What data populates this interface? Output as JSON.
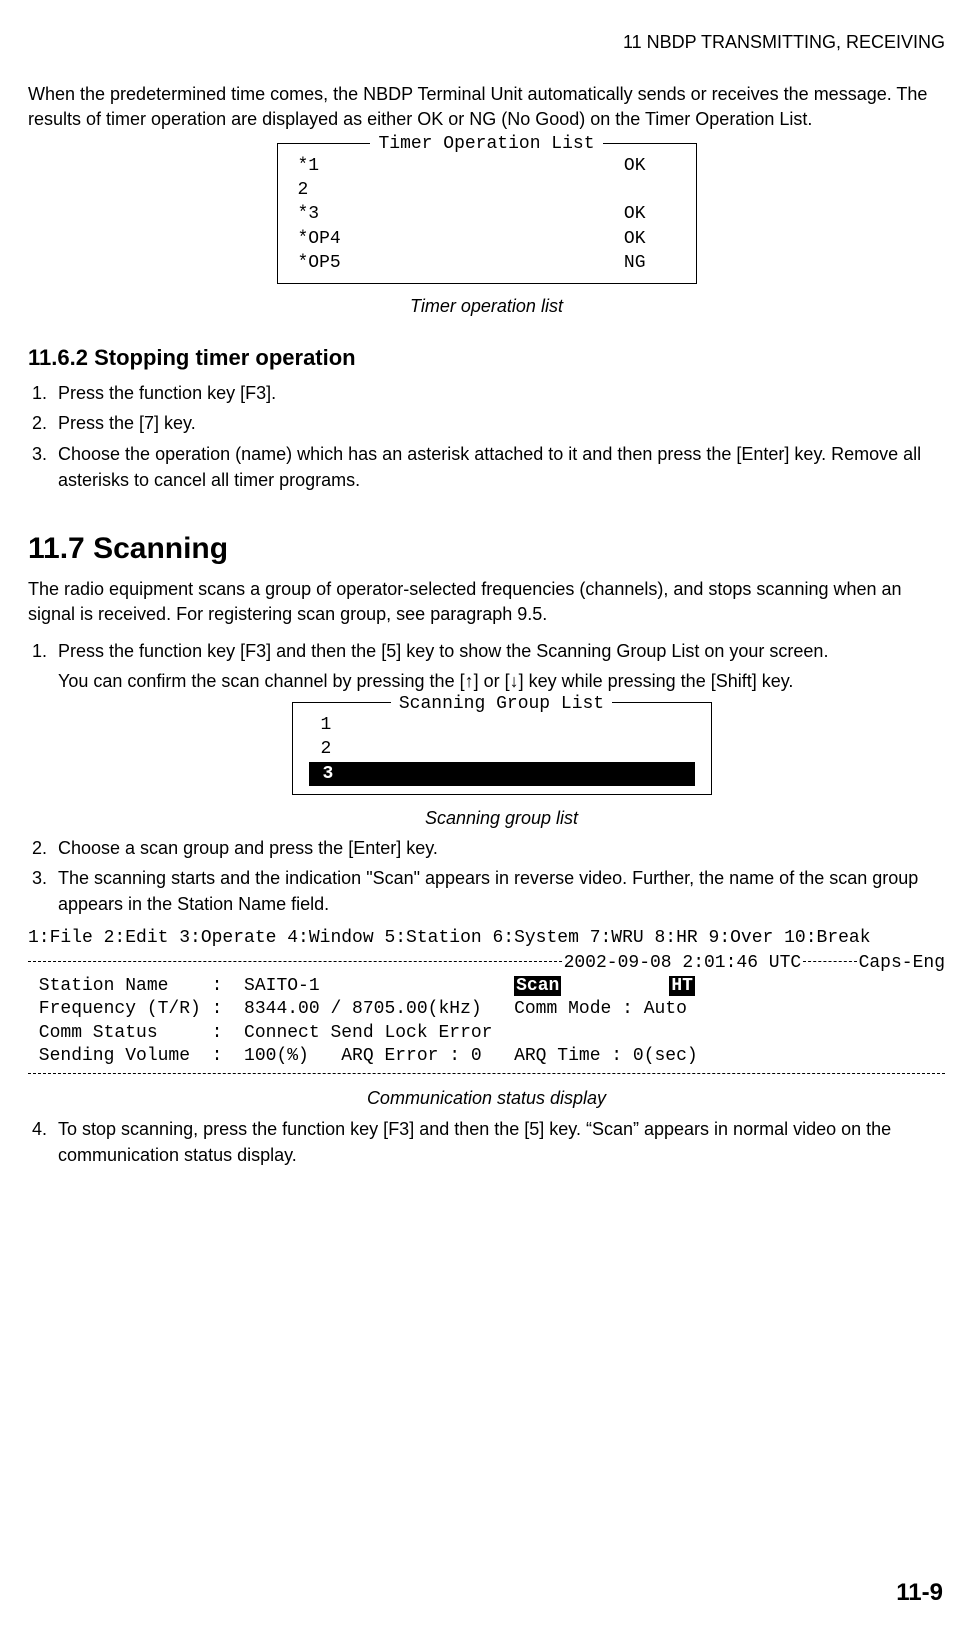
{
  "header": "11  NBDP TRANSMITTING, RECEIVING",
  "intro": "When the predetermined time comes, the NBDP Terminal Unit automatically sends or receives the message. The results of timer operation are displayed as either OK or NG (No Good) on the Timer Operation List.",
  "timer_list": {
    "title": "Timer Operation List",
    "rows": [
      {
        "label": "*1",
        "status": "OK"
      },
      {
        "label": " 2",
        "status": ""
      },
      {
        "label": "*3",
        "status": "OK"
      },
      {
        "label": "*OP4",
        "status": "OK"
      },
      {
        "label": "*OP5",
        "status": "NG"
      }
    ],
    "caption": "Timer operation list"
  },
  "sec1162": {
    "heading": "11.6.2 Stopping timer operation",
    "steps": [
      "Press the function key [F3].",
      "Press the [7] key.",
      "Choose the operation (name) which has an asterisk attached to it and then press the [Enter] key. Remove all asterisks to cancel all timer programs."
    ]
  },
  "sec117": {
    "heading": "11.7 Scanning",
    "para": "The radio equipment scans a group of operator-selected frequencies (channels), and stops scanning when an signal is received. For registering scan group, see paragraph 9.5.",
    "step1a": "Press the function key [F3] and then the [5] key to show the Scanning Group List on your screen.",
    "step1b_pre": "You can confirm the scan channel by pressing the [",
    "step1b_mid": "] or [",
    "step1b_post": "] key while pressing the [Shift] key.",
    "scan_list": {
      "title": "Scanning Group List",
      "items": [
        "1",
        "2"
      ],
      "selected": "3",
      "caption": "Scanning group list"
    },
    "step2": "Choose a scan group and press the [Enter] key.",
    "step3": "The scanning starts and the indication \"Scan\" appears in reverse video. Further, the name of the scan group appears in the Station Name field.",
    "status": {
      "menu": "1:File 2:Edit 3:Operate 4:Window 5:Station 6:System 7:WRU 8:HR 9:Over 10:Break",
      "timestamp": "2002-09-08 2:01:46 UTC",
      "caps": "Caps-Eng",
      "l1_left": " Station Name    :  SAITO-1                  ",
      "l1_scan": "Scan",
      "l1_gap": "          ",
      "l1_ht": "HT",
      "l2": " Frequency (T/R) :  8344.00 / 8705.00(kHz)   Comm Mode : Auto",
      "l3": " Comm Status     :  Connect Send Lock Error",
      "l4": " Sending Volume  :  100(%)   ARQ Error : 0   ARQ Time : 0(sec)",
      "caption": "Communication status display"
    },
    "step4": "To stop scanning, press the function key [F3] and then the [5] key. “Scan” appears in normal video on the communication status display."
  },
  "page_num": "11-9"
}
